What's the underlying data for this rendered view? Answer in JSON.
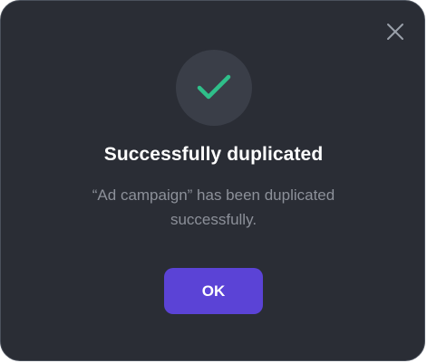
{
  "dialog": {
    "close_icon": "close-icon",
    "status_icon": "checkmark-icon",
    "title": "Successfully duplicated",
    "message": "“Ad campaign” has been duplicated successfully.",
    "ok_label": "OK"
  },
  "colors": {
    "background": "#2a2d35",
    "icon_circle": "#3a3e48",
    "checkmark": "#2fbf8a",
    "primary_button": "#5b43d6",
    "title_text": "#ffffff",
    "message_text": "#8c9099",
    "close_icon": "#9aa0aa"
  }
}
